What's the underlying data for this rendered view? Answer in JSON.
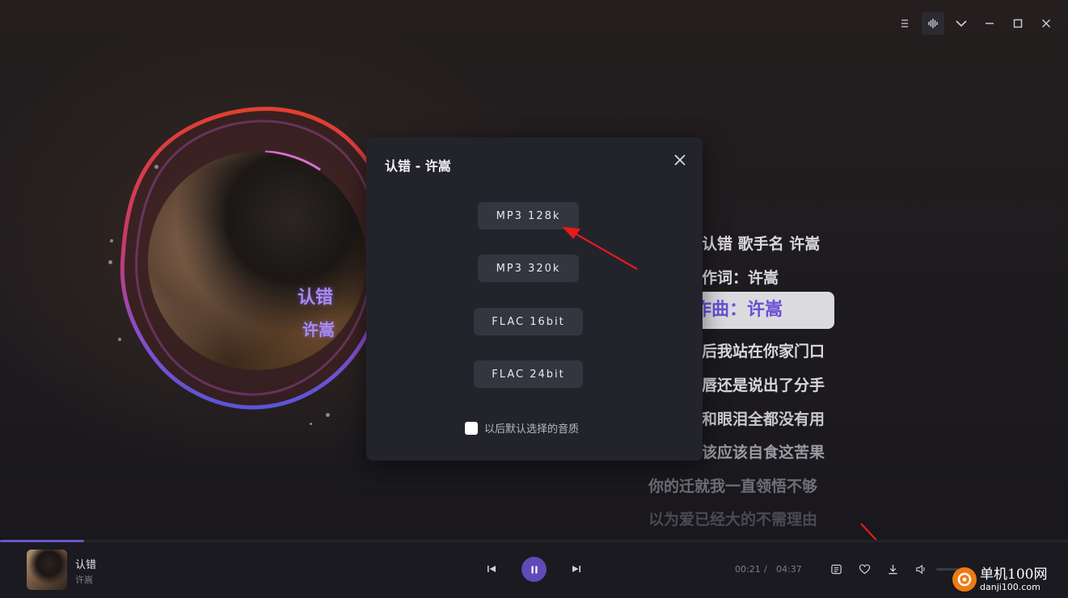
{
  "window": {
    "controls": [
      "menu-icon",
      "soundwave-icon",
      "collapse-icon",
      "minimize-icon",
      "maximize-icon",
      "close-icon"
    ]
  },
  "disc": {
    "cover_title": "认错",
    "cover_artist": "许嵩"
  },
  "lyrics": [
    "认错 歌手名 许嵩",
    "作词：许嵩",
    "作曲：许嵩",
    "后我站在你家门口",
    "唇还是说出了分手",
    "和眼泪全都没有用",
    "该应该自食这苦果",
    "你的迁就我一直领悟不够",
    "以为爱已经大的不需理由"
  ],
  "lyrics_current_index": 2,
  "modal": {
    "title": "认错 - 许嵩",
    "options": [
      "MP3 128k",
      "MP3 320k",
      "FLAC 16bit",
      "FLAC 24bit"
    ],
    "remember_label": "以后默认选择的音质",
    "remember_checked": false
  },
  "player": {
    "song_title": "认错",
    "song_artist": "许嵩",
    "current_time": "00:21",
    "separator": "/",
    "total_time": "04:37",
    "progress": 0.079,
    "volume": 0.0,
    "accent": "#5f4ab8"
  },
  "watermark": {
    "line1": "单机100网",
    "line2": "danji100.com"
  }
}
